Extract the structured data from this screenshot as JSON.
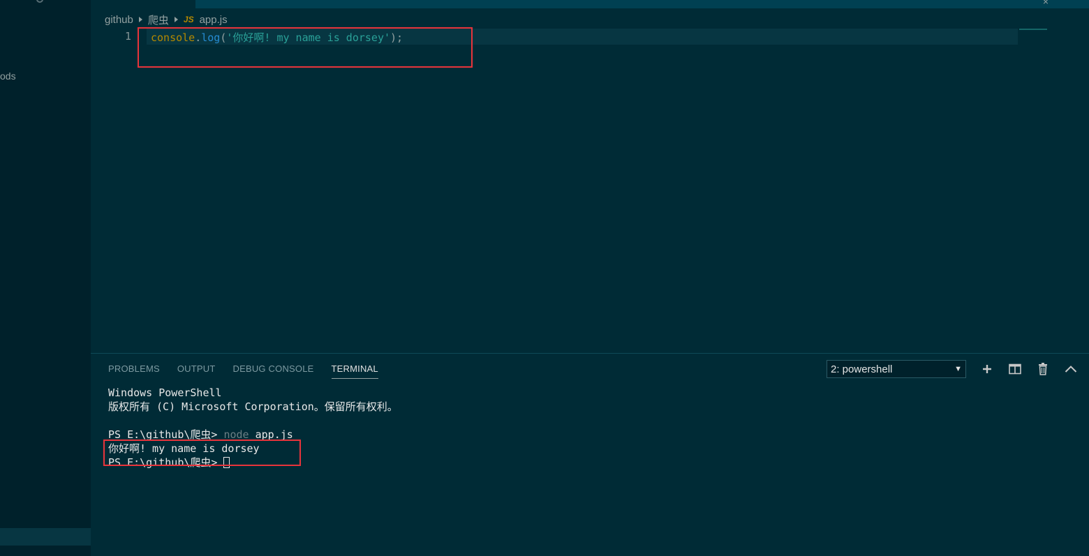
{
  "sidebar": {
    "partial_label": "ods"
  },
  "tabbar": {
    "close_glyph": "×"
  },
  "breadcrumb": {
    "items": [
      "github",
      "爬虫",
      "app.js"
    ],
    "file_icon": "JS"
  },
  "editor": {
    "line_number": "1",
    "code": {
      "object": "console",
      "dot": ".",
      "method": "log",
      "open": "(",
      "string": "'你好啊! my name is dorsey'",
      "close": ");"
    }
  },
  "panel": {
    "tabs": [
      "PROBLEMS",
      "OUTPUT",
      "DEBUG CONSOLE",
      "TERMINAL"
    ],
    "active_tab": "TERMINAL",
    "terminal_select": "2: powershell",
    "actions": [
      "plus-icon",
      "split-icon",
      "trash-icon",
      "chevron-up-icon"
    ]
  },
  "terminal": {
    "line1": "Windows PowerShell",
    "line2": "版权所有 (C) Microsoft Corporation。保留所有权利。",
    "prompt1": "PS E:\\github\\爬虫> ",
    "cmd_node": "node",
    "cmd_args": " app.js",
    "output": "你好啊! my name is dorsey",
    "prompt2": "PS E:\\github\\爬虫> "
  },
  "colors": {
    "background": "#002b36",
    "highlight_box": "#e8343b",
    "string": "#2aa198",
    "keyword": "#b58900",
    "function": "#268bd2"
  }
}
